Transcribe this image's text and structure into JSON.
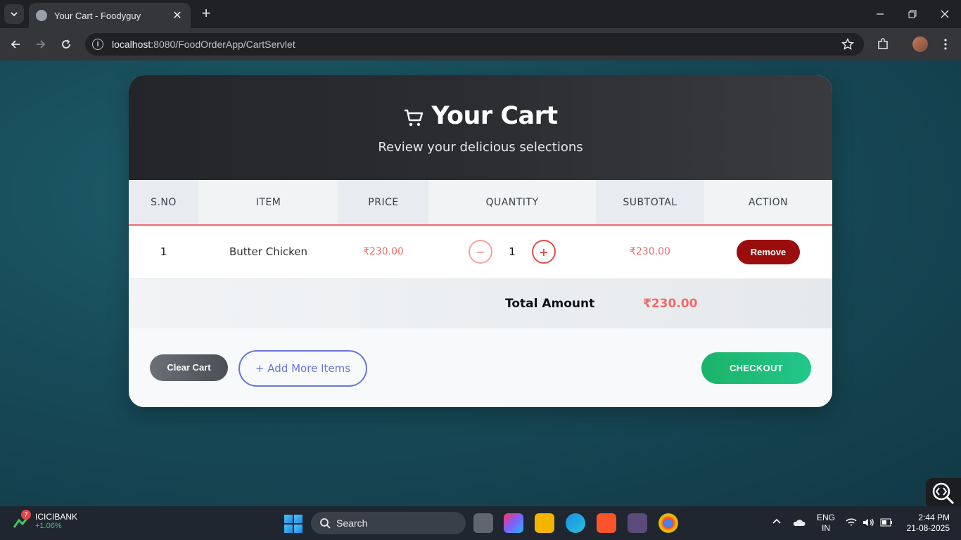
{
  "browser": {
    "tab_title": "Your Cart - Foodyguy",
    "url_host": "localhost",
    "url_path": ":8080/FoodOrderApp/CartServlet"
  },
  "cart": {
    "title": "Your Cart",
    "subtitle": "Review your delicious selections",
    "columns": [
      "S.NO",
      "ITEM",
      "PRICE",
      "QUANTITY",
      "SUBTOTAL",
      "ACTION"
    ],
    "rows": [
      {
        "sno": "1",
        "item": "Butter Chicken",
        "price": "₹230.00",
        "quantity": "1",
        "subtotal": "₹230.00",
        "action": "Remove"
      }
    ],
    "total_label": "Total Amount",
    "total_value": "₹230.00",
    "buttons": {
      "clear": "Clear Cart",
      "add_more": "+ Add More Items",
      "checkout": "CHECKOUT"
    },
    "qty_minus": "−",
    "qty_plus": "+"
  },
  "taskbar": {
    "stock_name": "ICICIBANK",
    "stock_change": "+1.06%",
    "stock_badge": "7",
    "search": "Search",
    "lang_top": "ENG",
    "lang_bottom": "IN",
    "time": "2:44 PM",
    "date": "21-08-2025"
  },
  "colors": {
    "accent_red": "#ef6b6b",
    "remove_red": "#9b0d0d",
    "checkout_green": "#1bb36a",
    "add_more_blue": "#6a75d8"
  }
}
